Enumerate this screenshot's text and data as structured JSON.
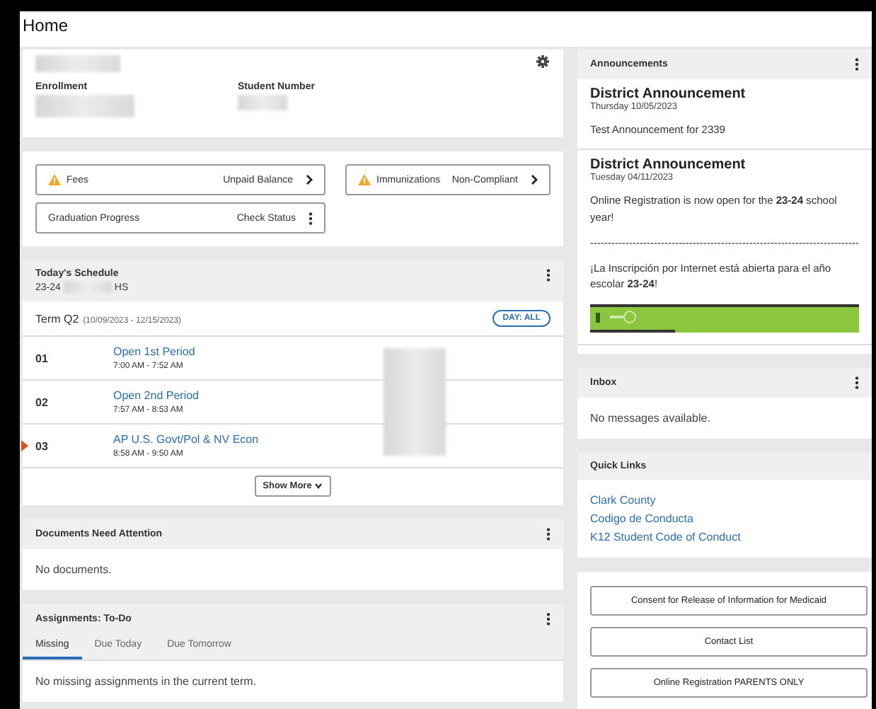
{
  "page_title": "Home",
  "profile": {
    "enrollment_label": "Enrollment",
    "student_number_label": "Student Number"
  },
  "alerts": [
    {
      "warning": true,
      "label": "Fees",
      "status": "Unpaid Balance",
      "kind": "chevron"
    },
    {
      "warning": true,
      "label": "Immunizations",
      "status": "Non-Compliant",
      "kind": "chevron"
    },
    {
      "warning": false,
      "label": "Graduation Progress",
      "status": "Check Status",
      "kind": "menu"
    }
  ],
  "schedule": {
    "title": "Today's Schedule",
    "school_prefix": "23-24",
    "school_suffix": "HS",
    "term": "Term Q2",
    "term_dates": "(10/09/2023 - 12/15/2023)",
    "day_filter": "DAY: ALL",
    "show_more": "Show More",
    "periods": [
      {
        "number": "01",
        "course": "Open 1st Period",
        "time": "7:00 AM - 7:52 AM",
        "current": false
      },
      {
        "number": "02",
        "course": "Open 2nd Period",
        "time": "7:57 AM - 8:53 AM",
        "current": false
      },
      {
        "number": "03",
        "course": "AP U.S. Govt/Pol & NV Econ",
        "time": "8:58 AM - 9:50 AM",
        "current": true
      }
    ]
  },
  "documents": {
    "title": "Documents Need Attention",
    "message": "No documents."
  },
  "assignments": {
    "title": "Assignments: To-Do",
    "message": "No missing assignments in the current term.",
    "tabs": [
      {
        "label": "Missing",
        "selected": true
      },
      {
        "label": "Due Today",
        "selected": false
      },
      {
        "label": "Due Tomorrow",
        "selected": false
      }
    ]
  },
  "announcements": {
    "title": "Announcements",
    "items": [
      {
        "title": "District Announcement",
        "date": "Thursday 10/05/2023",
        "paragraphs": [
          "Test Announcement for 2339"
        ],
        "banner": false
      },
      {
        "title": "District Announcement",
        "date": "Tuesday 04/11/2023",
        "paragraphs": [
          "Online Registration is now open for the **23-24** school year!",
          "----------------------------------------------------------------------------",
          "¡La Inscripción por Internet está abierta para el año escolar **23-24**!"
        ],
        "banner": true
      }
    ]
  },
  "inbox": {
    "title": "Inbox",
    "message": "No messages available."
  },
  "quick_links": {
    "title": "Quick Links",
    "links": [
      "Clark County",
      "Codigo de Conducta",
      "K12 Student Code of Conduct"
    ]
  },
  "link_buttons": [
    "Consent for Release of Information for Medicaid",
    "Contact List",
    "Online Registration PARENTS ONLY"
  ]
}
